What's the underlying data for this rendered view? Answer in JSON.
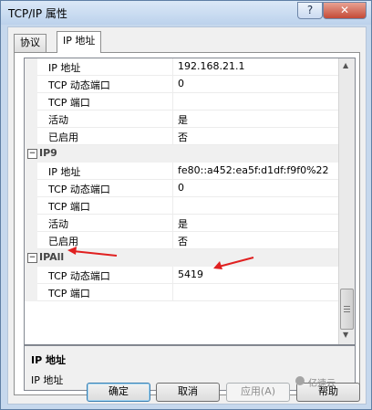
{
  "window": {
    "title": "TCP/IP 属性",
    "help_label": "?",
    "close_label": "✕"
  },
  "tabs": [
    {
      "label": "协议"
    },
    {
      "label": "IP 地址"
    }
  ],
  "grid": {
    "rows_top": [
      {
        "name": "IP 地址",
        "value": "192.168.21.1"
      },
      {
        "name": "TCP 动态端口",
        "value": "0"
      },
      {
        "name": "TCP 端口",
        "value": ""
      },
      {
        "name": "活动",
        "value": "是"
      },
      {
        "name": "已启用",
        "value": "否"
      }
    ],
    "ip9": {
      "label": "IP9",
      "expander": "−",
      "rows": [
        {
          "name": "IP 地址",
          "value": "fe80::a452:ea5f:d1df:f9f0%22"
        },
        {
          "name": "TCP 动态端口",
          "value": "0"
        },
        {
          "name": "TCP 端口",
          "value": ""
        },
        {
          "name": "活动",
          "value": "是"
        },
        {
          "name": "已启用",
          "value": "否"
        }
      ]
    },
    "ipall": {
      "label": "IPAll",
      "expander": "−",
      "rows": [
        {
          "name": "TCP 动态端口",
          "value": "5419"
        },
        {
          "name": "TCP 端口",
          "value": ""
        }
      ]
    }
  },
  "description": {
    "title": "IP 地址",
    "text": "IP 地址"
  },
  "buttons": {
    "ok": "确定",
    "cancel": "取消",
    "apply": "应用(A)",
    "help": "帮助"
  },
  "watermark": "亿速云",
  "colors": {
    "annotation_arrow": "#e02020",
    "title_bar": "#c6d8ed"
  }
}
